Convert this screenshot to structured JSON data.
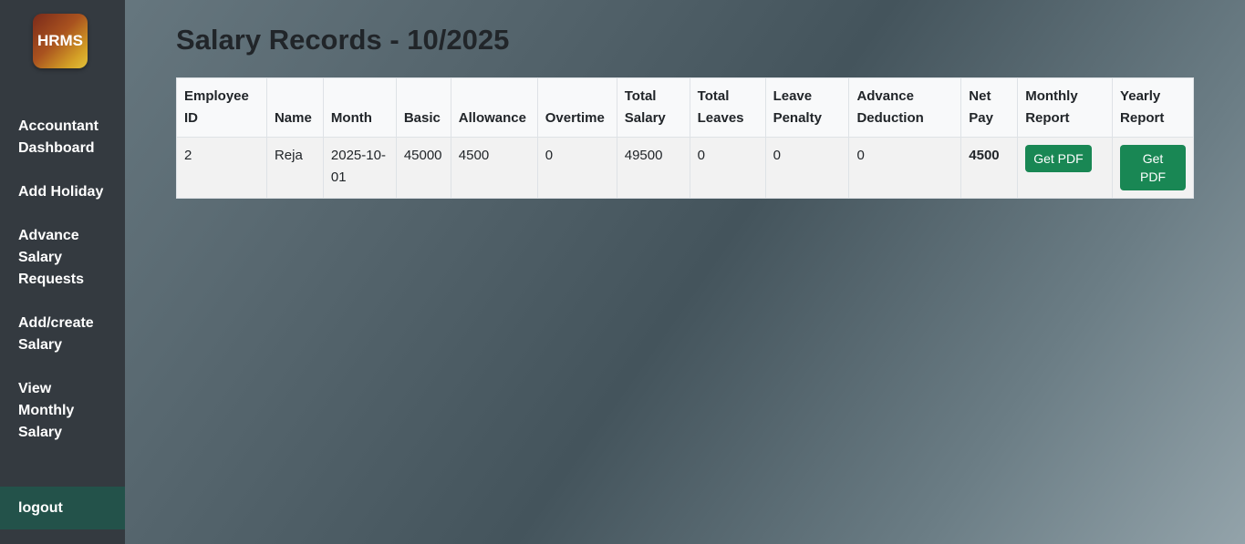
{
  "sidebar": {
    "logo_text": "HRMS",
    "items": [
      {
        "label": "Accountant Dashboard"
      },
      {
        "label": "Add Holiday"
      },
      {
        "label": "Advance Salary Requests"
      },
      {
        "label": "Add/create Salary"
      },
      {
        "label": "View Monthly Salary"
      }
    ],
    "logout_label": "logout"
  },
  "main": {
    "title": "Salary Records - 10/2025",
    "table": {
      "headers": [
        "Employee ID",
        "Name",
        "Month",
        "Basic",
        "Allowance",
        "Overtime",
        "Total Salary",
        "Total Leaves",
        "Leave Penalty",
        "Advance Deduction",
        "Net Pay",
        "Monthly Report",
        "Yearly Report"
      ],
      "rows": [
        {
          "employee_id": "2",
          "name": "Reja",
          "month": "2025-10-01",
          "basic": "45000",
          "allowance": "4500",
          "overtime": "0",
          "total_salary": "49500",
          "total_leaves": "0",
          "leave_penalty": "0",
          "advance_deduction": "0",
          "net_pay": "4500",
          "monthly_report_label": "Get PDF",
          "yearly_report_label": "Get PDF"
        }
      ]
    }
  },
  "colors": {
    "sidebar_bg": "#343a40",
    "logout_bg": "#23524a",
    "button_green": "#198754"
  }
}
